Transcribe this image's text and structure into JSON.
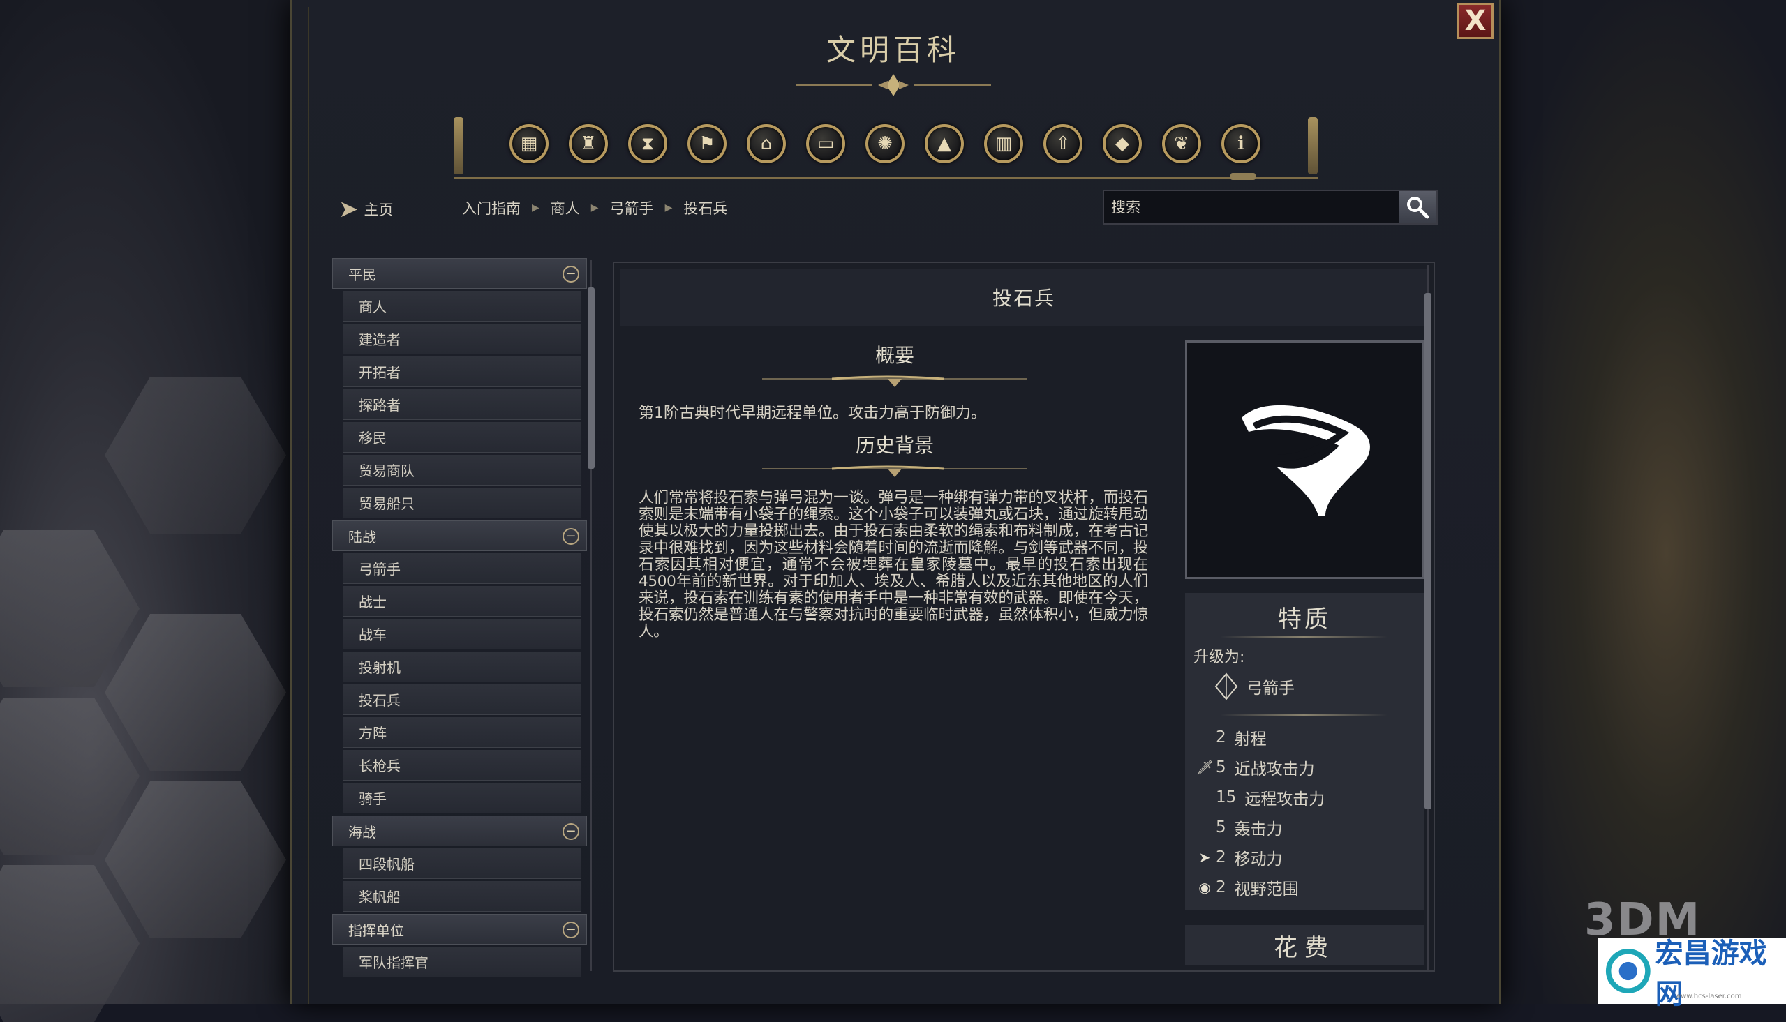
{
  "window": {
    "title": "文明百科",
    "close_label": "X"
  },
  "category_icons": [
    "box-icon",
    "vase-icon",
    "hourglass-icon",
    "flag-icon",
    "temple-icon",
    "book-icon",
    "atom-icon",
    "mountains-icon",
    "district-icon",
    "upgrade-arrow-icon",
    "diamond-icon",
    "dove-icon",
    "info-icon"
  ],
  "nav": {
    "home_label": "主页",
    "breadcrumbs": [
      "入门指南",
      "商人",
      "弓箭手",
      "投石兵"
    ],
    "search_placeholder": "搜索"
  },
  "sidebar": {
    "groups": [
      {
        "label": "平民",
        "items": [
          "商人",
          "建造者",
          "开拓者",
          "探路者",
          "移民",
          "贸易商队",
          "贸易船只"
        ]
      },
      {
        "label": "陆战",
        "items": [
          "弓箭手",
          "战士",
          "战车",
          "投射机",
          "投石兵",
          "方阵",
          "长枪兵",
          "骑手"
        ]
      },
      {
        "label": "海战",
        "items": [
          "四段帆船",
          "桨帆船"
        ]
      },
      {
        "label": "指挥单位",
        "items": [
          "军队指挥官"
        ]
      }
    ]
  },
  "article": {
    "title": "投石兵",
    "summary_heading": "概要",
    "summary_text": "第1阶古典时代早期远程单位。攻击力高于防御力。",
    "history_heading": "历史背景",
    "history_text": "人们常常将投石索与弹弓混为一谈。弹弓是一种绑有弹力带的叉状杆，而投石索则是末端带有小袋子的绳索。这个小袋子可以装弹丸或石块，通过旋转甩动使其以极大的力量投掷出去。由于投石索由柔软的绳索和布料制成，在考古记录中很难找到，因为这些材料会随着时间的流逝而降解。与剑等武器不同，投石索因其相对便宜，通常不会被埋葬在皇家陵墓中。最早的投石索出现在4500年前的新世界。对于印加人、埃及人、希腊人以及近东其他地区的人们来说，投石索在训练有素的使用者手中是一种非常有效的武器。即使在今天，投石索仍然是普通人在与警察对抗时的重要临时武器，虽然体积小，但威力惊人。"
  },
  "traits": {
    "heading": "特质",
    "upgrade_label": "升级为:",
    "upgrade_target": "弓箭手",
    "stats": [
      {
        "icon": "",
        "value": "2",
        "label": "射程"
      },
      {
        "icon": "sword-icon",
        "value": "5",
        "label": "近战攻击力"
      },
      {
        "icon": "",
        "value": "15",
        "label": "远程攻击力"
      },
      {
        "icon": "",
        "value": "5",
        "label": "轰击力"
      },
      {
        "icon": "movement-icon",
        "value": "2",
        "label": "移动力"
      },
      {
        "icon": "eye-icon",
        "value": "2",
        "label": "视野范围"
      }
    ]
  },
  "cost": {
    "heading": "花费"
  },
  "watermark": {
    "brand": "3DM",
    "site": "宏昌游戏网",
    "url": "www.hcs-laser.com"
  }
}
